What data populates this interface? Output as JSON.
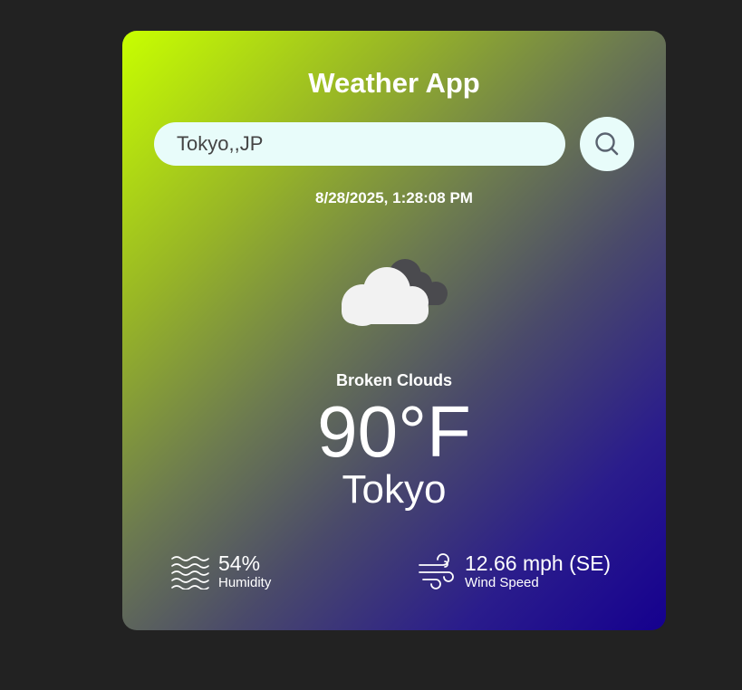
{
  "app": {
    "title": "Weather App"
  },
  "search": {
    "value": "Tokyo,,JP",
    "button_icon": "search-icon"
  },
  "datetime": "8/28/2025, 1:28:08 PM",
  "weather": {
    "icon": "broken-clouds-icon",
    "description": "Broken Clouds",
    "temperature": "90°F",
    "city": "Tokyo"
  },
  "stats": {
    "humidity": {
      "icon": "humidity-waves-icon",
      "value": "54%",
      "label": "Humidity"
    },
    "wind": {
      "icon": "wind-icon",
      "value": "12.66 mph (SE)",
      "label": "Wind Speed"
    }
  },
  "colors": {
    "background": "#222222",
    "gradient_start": "#c8ff00",
    "gradient_end": "#15008f",
    "input_bg": "#e8fcfa"
  }
}
